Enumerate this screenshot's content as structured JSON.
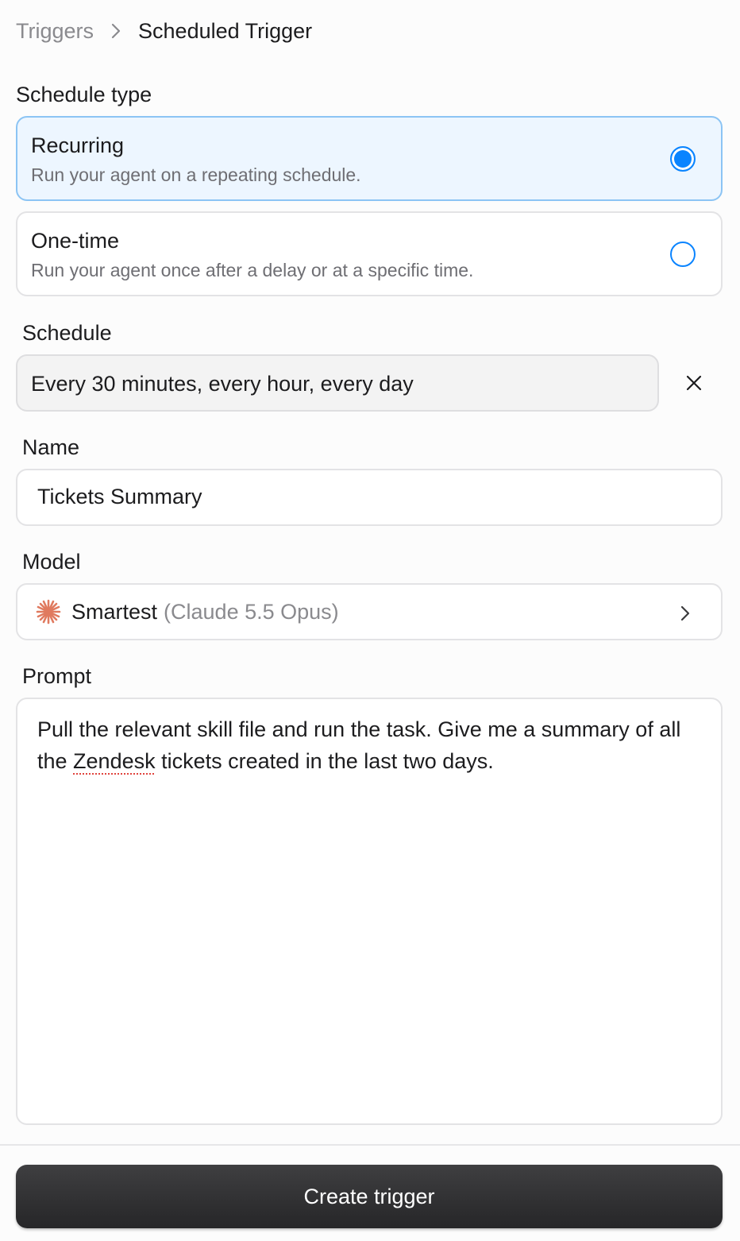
{
  "breadcrumb": {
    "parent": "Triggers",
    "current": "Scheduled Trigger"
  },
  "schedule_type": {
    "label": "Schedule type",
    "options": [
      {
        "title": "Recurring",
        "description": "Run your agent on a repeating schedule.",
        "selected": true
      },
      {
        "title": "One-time",
        "description": "Run your agent once after a delay or at a specific time.",
        "selected": false
      }
    ]
  },
  "schedule": {
    "label": "Schedule",
    "value": "Every 30 minutes, every hour, every day"
  },
  "name": {
    "label": "Name",
    "value": "Tickets Summary"
  },
  "model": {
    "label": "Model",
    "name": "Smartest",
    "detail": "(Claude 5.5 Opus)",
    "icon": "claude-spark-icon"
  },
  "prompt": {
    "label": "Prompt",
    "text_before": "Pull the relevant skill file and run the task. Give me a summary of all the ",
    "misspelled_word": "Zendesk",
    "text_after": " tickets created in the last two days."
  },
  "actions": {
    "create_label": "Create trigger"
  },
  "colors": {
    "accent": "#0a84ff",
    "selected_bg": "#edf6ff",
    "model_icon": "#e07a5f",
    "button_bg": "#2f2f31"
  }
}
